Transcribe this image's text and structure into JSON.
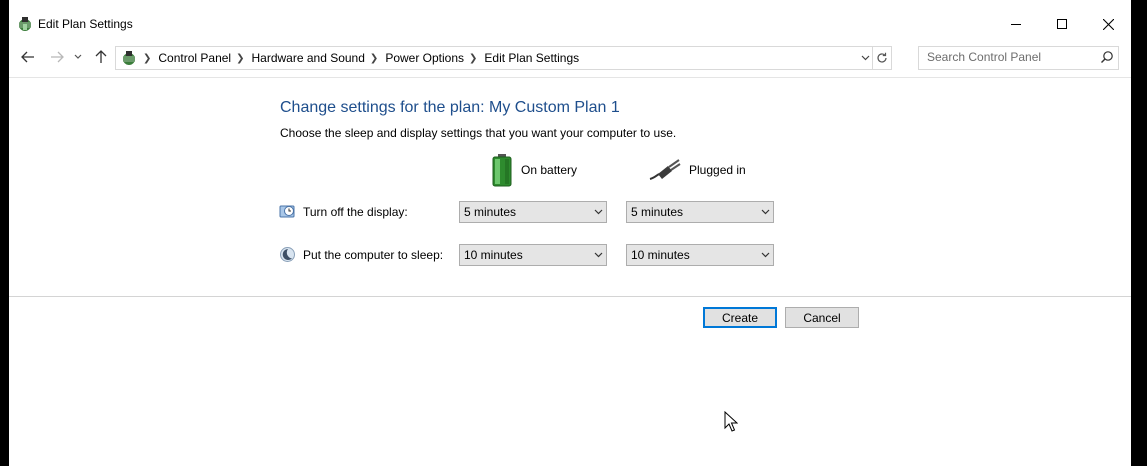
{
  "window": {
    "title": "Edit Plan Settings",
    "icons": {
      "app": "power-options-icon",
      "minimize": "minimize-icon",
      "maximize": "maximize-icon",
      "close": "close-icon"
    }
  },
  "nav": {
    "breadcrumbs": [
      "Control Panel",
      "Hardware and Sound",
      "Power Options",
      "Edit Plan Settings"
    ],
    "search_placeholder": "Search Control Panel"
  },
  "content": {
    "heading": "Change settings for the plan: My Custom Plan 1",
    "description": "Choose the sleep and display settings that you want your computer to use.",
    "columns": {
      "battery": "On battery",
      "plugged": "Plugged in"
    },
    "rows": [
      {
        "label": "Turn off the display:",
        "battery": "5 minutes",
        "plugged": "5 minutes"
      },
      {
        "label": "Put the computer to sleep:",
        "battery": "10 minutes",
        "plugged": "10 minutes"
      }
    ]
  },
  "buttons": {
    "create": "Create",
    "cancel": "Cancel"
  },
  "colors": {
    "heading": "#1e4e8c",
    "focus_border": "#0078d7",
    "button_bg": "#e1e1e1",
    "select_bg": "#e5e5e5"
  }
}
